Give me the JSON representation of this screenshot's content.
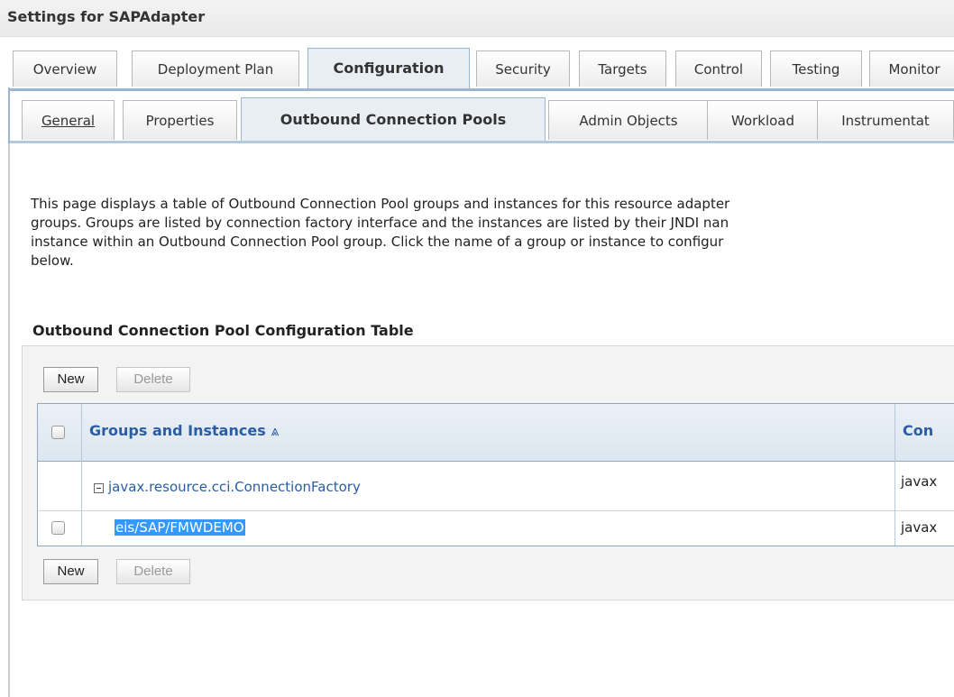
{
  "header": {
    "title": "Settings for SAPAdapter"
  },
  "tabs": [
    {
      "label": "Overview"
    },
    {
      "label": "Deployment Plan"
    },
    {
      "label": "Configuration",
      "active": true
    },
    {
      "label": "Security"
    },
    {
      "label": "Targets"
    },
    {
      "label": "Control"
    },
    {
      "label": "Testing"
    },
    {
      "label": "Monitor"
    }
  ],
  "subtabs": [
    {
      "label": "General"
    },
    {
      "label": "Properties"
    },
    {
      "label": "Outbound Connection Pools",
      "active": true
    },
    {
      "label": "Admin Objects"
    },
    {
      "label": "Workload"
    },
    {
      "label": "Instrumentat"
    }
  ],
  "description": {
    "line1": "This page displays a table of Outbound Connection Pool groups and instances for this resource adapter",
    "line2": "groups. Groups are listed by connection factory interface and the instances are listed by their JNDI nan",
    "line3": "instance within an Outbound Connection Pool group. Click the name of a group or instance to configur",
    "line4": "below."
  },
  "section": {
    "title": "Outbound Connection Pool Configuration Table"
  },
  "toolbar_top": {
    "new_label": "New",
    "delete_label": "Delete"
  },
  "toolbar_bottom": {
    "new_label": "New",
    "delete_label": "Delete"
  },
  "table": {
    "columns": {
      "groups": "Groups and Instances",
      "sort_icon": "⩓",
      "connection": "Con"
    },
    "rows": [
      {
        "name": "javax.resource.cci.ConnectionFactory",
        "connection": "javax"
      },
      {
        "name": "eis/SAP/FMWDEMO",
        "connection": "javax"
      }
    ]
  },
  "colors": {
    "link": "#2a5da3",
    "selection": "#3399ff",
    "tab_active_bg": "#e8eef4"
  }
}
